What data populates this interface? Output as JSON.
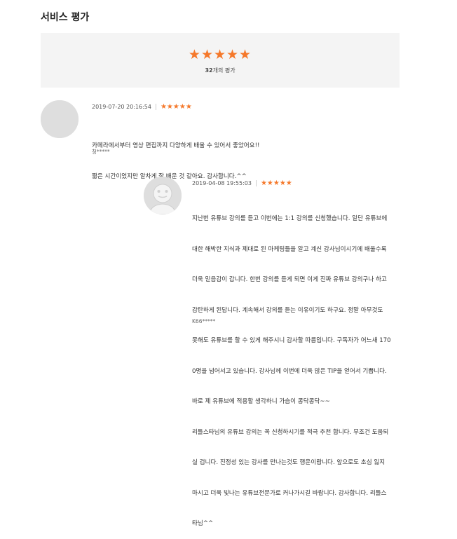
{
  "section_title": "서비스 평가",
  "summary": {
    "stars": "★★★★★",
    "count_num": "32",
    "count_suffix": "개의 평가"
  },
  "colors": {
    "star": "#f5782a",
    "summary_bg": "#f4f4f4"
  },
  "reviews": [
    {
      "date": "2019-07-20 20:16:54",
      "stars": "★★★★★",
      "lines": [
        "카메라에서부터 영상 편집까지 다양하게 배울 수 있어서 좋았어요!!",
        "짧은 시간이었지만 알차게 잘 배운 것 같아요. 감사합니다.^^"
      ],
      "author": "청*****"
    },
    {
      "date": "2019-04-08 19:55:03",
      "stars": "★★★★★",
      "lines": [
        "지난번 유튜브 강의를 듣고 이번에는 1:1 강의를 신청했습니다. 일단 유튜브에",
        "대한 해박한 지식과 제대로 된 마케팅들을 알고 계신 강사님이시기에 배울수록",
        "더욱 믿음감이 갑니다. 한번 강의를 듣게 되면 이게 진짜 유튜브 강의구나 하고",
        "감탄하게 된답니다. 계속해서 강의를 듣는 이유이기도 하구요. 정말 아무것도",
        "못해도 유튜브를 할 수 있게 해주시니 감사할 따름입니다. 구독자가 어느새 170",
        "0명을 넘어서고 있습니다. 강사님께 이번에 더욱 많은 TIP을 얻어서 기쁩니다.",
        "바로 제 유튜브에 적용할 생각하니 가슴이 콩닥콩닥~~",
        "리틀스타님의 유튜브 강의는 꼭 신청하시기를 적극 추천 합니다. 무조건 도움되",
        "실 겁니다. 진정성 있는 강사를 만나는것도 행운이랍니다. 앞으로도 초심 잃지",
        "마시고 더욱 빛나는 유튜브전문가로 커나가시길 바랍니다. 감사합니다. 리틀스",
        "타님^^"
      ],
      "author": "K66*****"
    }
  ]
}
